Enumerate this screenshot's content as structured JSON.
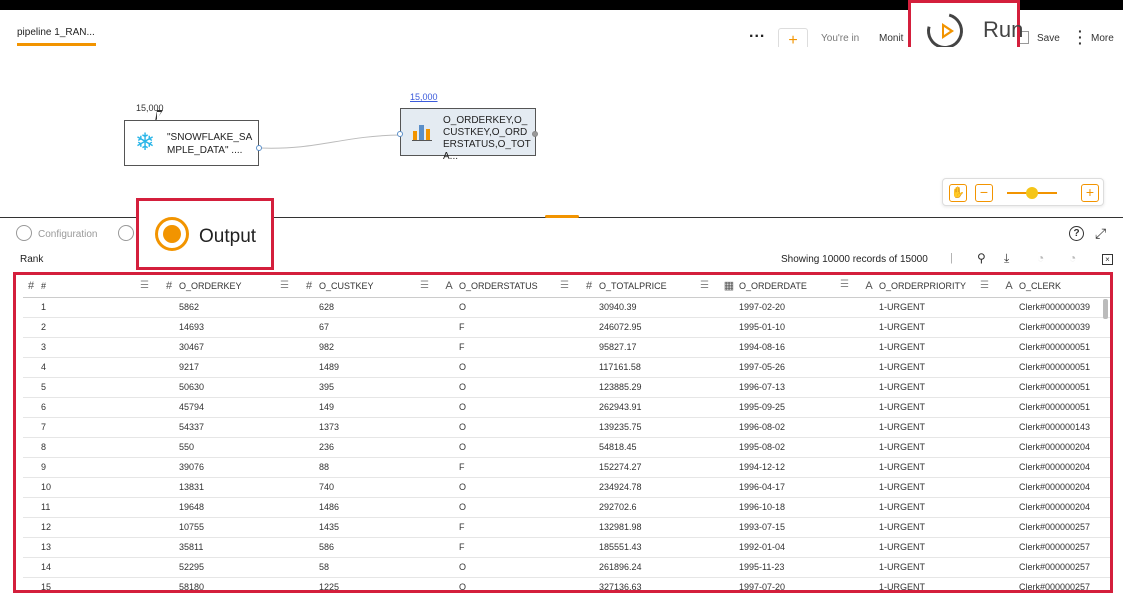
{
  "header": {
    "tab_title": "pipeline 1_RAN...",
    "dots": "...",
    "add_symbol": "+",
    "youre_in": "You're in",
    "mode": "Monit",
    "run_label": "Run",
    "save_label": "Save",
    "more_label": "More"
  },
  "canvas": {
    "source_node": {
      "count": "15,000",
      "label": "\"SNOWFLAKE_SAMPLE_DATA\" ...."
    },
    "rank_node": {
      "count": "15,000",
      "label": "O_ORDERKEY,O_CUSTKEY,O_ORDERSTATUS,O_TOTA..."
    },
    "zoom_level": 0.5
  },
  "panel": {
    "configuration_tab": "Configuration",
    "output_tab": "Output",
    "section_title": "Rank",
    "records_info": "Showing 10000 records of 15000"
  },
  "table": {
    "columns": [
      {
        "type": "#",
        "name": "#"
      },
      {
        "type": "#",
        "name": "O_ORDERKEY"
      },
      {
        "type": "#",
        "name": "O_CUSTKEY"
      },
      {
        "type": "A",
        "name": "O_ORDERSTATUS"
      },
      {
        "type": "#",
        "name": "O_TOTALPRICE"
      },
      {
        "type": "date",
        "name": "O_ORDERDATE"
      },
      {
        "type": "A",
        "name": "O_ORDERPRIORITY"
      },
      {
        "type": "A",
        "name": "O_CLERK"
      }
    ],
    "rows": [
      [
        "1",
        "5862",
        "628",
        "O",
        "30940.39",
        "1997-02-20",
        "1-URGENT",
        "Clerk#000000039"
      ],
      [
        "2",
        "14693",
        "67",
        "F",
        "246072.95",
        "1995-01-10",
        "1-URGENT",
        "Clerk#000000039"
      ],
      [
        "3",
        "30467",
        "982",
        "F",
        "95827.17",
        "1994-08-16",
        "1-URGENT",
        "Clerk#000000051"
      ],
      [
        "4",
        "9217",
        "1489",
        "O",
        "117161.58",
        "1997-05-26",
        "1-URGENT",
        "Clerk#000000051"
      ],
      [
        "5",
        "50630",
        "395",
        "O",
        "123885.29",
        "1996-07-13",
        "1-URGENT",
        "Clerk#000000051"
      ],
      [
        "6",
        "45794",
        "149",
        "O",
        "262943.91",
        "1995-09-25",
        "1-URGENT",
        "Clerk#000000051"
      ],
      [
        "7",
        "54337",
        "1373",
        "O",
        "139235.75",
        "1996-08-02",
        "1-URGENT",
        "Clerk#000000143"
      ],
      [
        "8",
        "550",
        "236",
        "O",
        "54818.45",
        "1995-08-02",
        "1-URGENT",
        "Clerk#000000204"
      ],
      [
        "9",
        "39076",
        "88",
        "F",
        "152274.27",
        "1994-12-12",
        "1-URGENT",
        "Clerk#000000204"
      ],
      [
        "10",
        "13831",
        "740",
        "O",
        "234924.78",
        "1996-04-17",
        "1-URGENT",
        "Clerk#000000204"
      ],
      [
        "11",
        "19648",
        "1486",
        "O",
        "292702.6",
        "1996-10-18",
        "1-URGENT",
        "Clerk#000000204"
      ],
      [
        "12",
        "10755",
        "1435",
        "F",
        "132981.98",
        "1993-07-15",
        "1-URGENT",
        "Clerk#000000257"
      ],
      [
        "13",
        "35811",
        "586",
        "F",
        "185551.43",
        "1992-01-04",
        "1-URGENT",
        "Clerk#000000257"
      ],
      [
        "14",
        "52295",
        "58",
        "O",
        "261896.24",
        "1995-11-23",
        "1-URGENT",
        "Clerk#000000257"
      ],
      [
        "15",
        "58180",
        "1225",
        "O",
        "327136.63",
        "1997-07-20",
        "1-URGENT",
        "Clerk#000000257"
      ]
    ]
  },
  "colors": {
    "accent": "#f29400",
    "highlight_border": "#d41f3c",
    "node_icon": "#29b5e8"
  }
}
